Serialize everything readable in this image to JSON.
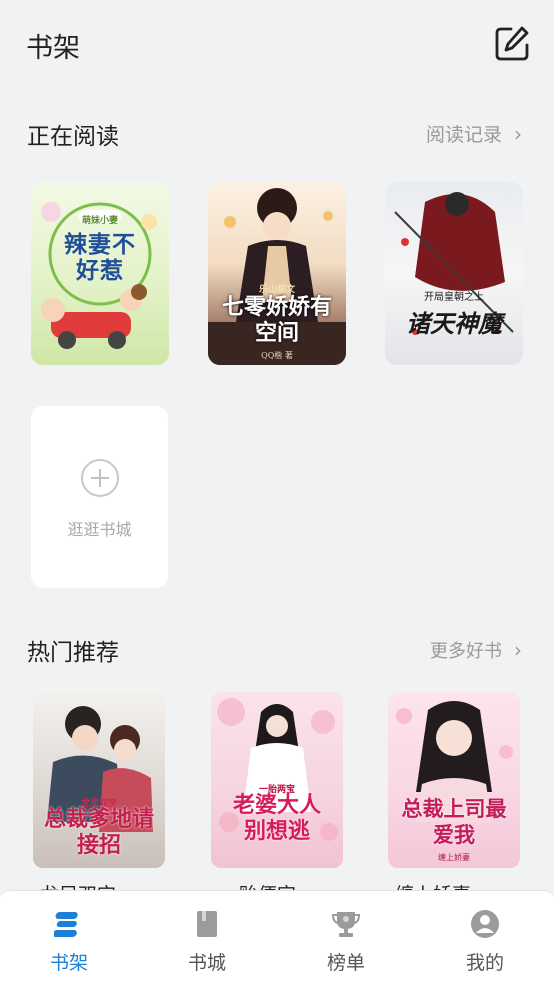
{
  "header": {
    "title": "书架",
    "edit_icon": "edit-icon"
  },
  "reading": {
    "title": "正在阅读",
    "link": "阅读记录",
    "books": [
      {
        "cover_text": "辣妻不好惹",
        "cover_tag": "萌妹小妻"
      },
      {
        "cover_text": "七零娇娇有空间",
        "cover_tag": "乐山都文",
        "cover_author": "QQ楷 著"
      },
      {
        "cover_text": "诸天神魔",
        "cover_tag": "开局皇朝之上"
      }
    ],
    "add_label": "逛逛书城"
  },
  "recommend": {
    "title": "热门推荐",
    "link": "更多好书",
    "books": [
      {
        "name": "龙凤双宝",
        "cover_text": "总裁爹地请接招",
        "cover_tag": "龙凤双宝"
      },
      {
        "name": "贻便宜",
        "cover_text": "老婆大人别想逃",
        "cover_tag": "一胎两宝"
      },
      {
        "name": "缠上娇妻",
        "cover_text": "总裁上司最爱我",
        "cover_tag": "缠上娇妻"
      }
    ]
  },
  "tabbar": {
    "active": "书架",
    "tabs": [
      {
        "label": "书架",
        "icon": "bookshelf-icon"
      },
      {
        "label": "书城",
        "icon": "book-icon"
      },
      {
        "label": "榜单",
        "icon": "trophy-icon"
      },
      {
        "label": "我的",
        "icon": "user-icon"
      }
    ]
  },
  "colors": {
    "accent": "#1e7fd6",
    "background": "#f1f2f3",
    "muted": "#9a9a9a"
  }
}
